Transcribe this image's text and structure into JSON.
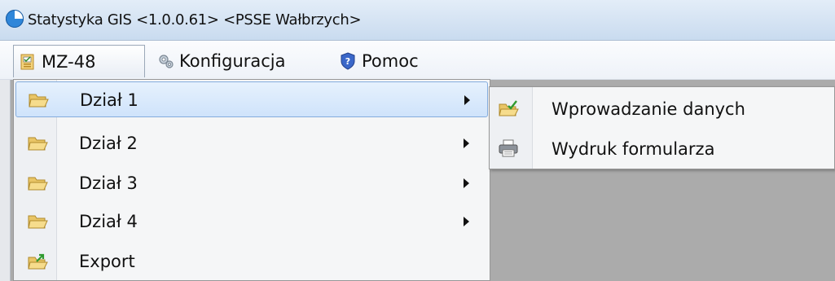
{
  "window": {
    "title": "Statystyka GIS <1.0.0.61> <PSSE Wałbrzych>",
    "icon": "app-globe-icon"
  },
  "menubar": {
    "items": [
      {
        "label": "MZ-48",
        "icon": "form-document-icon"
      },
      {
        "label": "Konfiguracja",
        "icon": "gears-icon"
      },
      {
        "label": "Pomoc",
        "icon": "help-shield-icon"
      }
    ]
  },
  "dropdown": {
    "items": [
      {
        "label": "Dział 1",
        "icon": "folder-open-icon",
        "has_submenu": true,
        "highlighted": true
      },
      {
        "label": "Dział 2",
        "icon": "folder-open-icon",
        "has_submenu": true
      },
      {
        "label": "Dział 3",
        "icon": "folder-open-icon",
        "has_submenu": true
      },
      {
        "label": "Dział 4",
        "icon": "folder-open-icon",
        "has_submenu": true
      },
      {
        "label": "Export",
        "icon": "folder-export-icon",
        "has_submenu": false
      }
    ]
  },
  "submenu": {
    "items": [
      {
        "label": "Wprowadzanie danych",
        "icon": "data-entry-icon"
      },
      {
        "label": "Wydruk formularza",
        "icon": "printer-icon"
      }
    ]
  },
  "colors": {
    "highlight": "#cfe3fb",
    "highlight_border": "#84acdd",
    "workspace": "#ababab"
  }
}
